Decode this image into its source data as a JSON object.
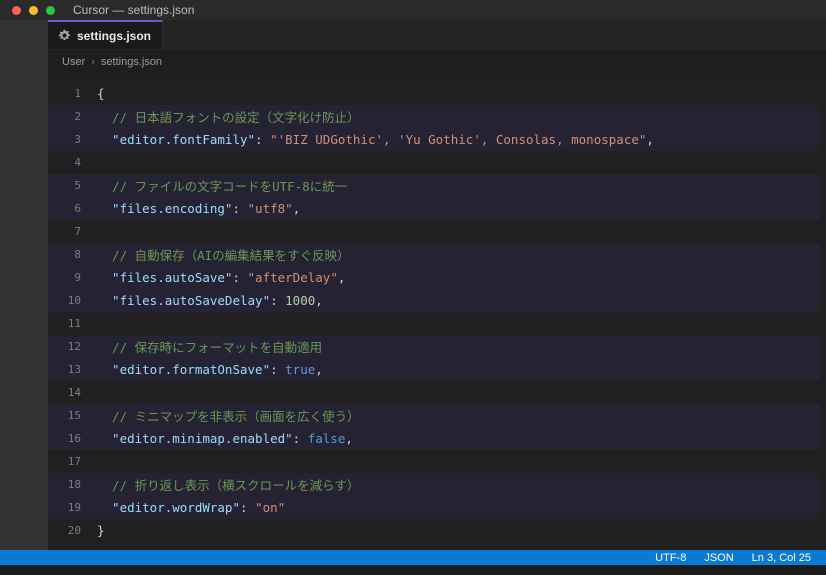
{
  "window": {
    "title": "Cursor — settings.json"
  },
  "tab": {
    "label": "settings.json",
    "icon": "gear-icon"
  },
  "breadcrumb": {
    "segments": [
      "User",
      "settings.json"
    ],
    "separator": "›"
  },
  "editor": {
    "lines": [
      {
        "num": 1,
        "hl": false,
        "tokens": [
          {
            "c": "punct",
            "v": "{"
          }
        ]
      },
      {
        "num": 2,
        "hl": true,
        "tokens": [
          {
            "c": "comment",
            "v": "  // 日本語フォントの設定（文字化け防止）"
          }
        ]
      },
      {
        "num": 3,
        "hl": true,
        "tokens": [
          {
            "c": "key",
            "v": "  \"editor.fontFamily\""
          },
          {
            "c": "punct",
            "v": ": "
          },
          {
            "c": "string",
            "v": "\"'BIZ UDGothic', 'Yu Gothic', Consolas, monospace\""
          },
          {
            "c": "punct",
            "v": ","
          }
        ]
      },
      {
        "num": 4,
        "hl": false,
        "tokens": []
      },
      {
        "num": 5,
        "hl": true,
        "tokens": [
          {
            "c": "comment",
            "v": "  // ファイルの文字コードをUTF-8に統一"
          }
        ]
      },
      {
        "num": 6,
        "hl": true,
        "tokens": [
          {
            "c": "key",
            "v": "  \"files.encoding\""
          },
          {
            "c": "punct",
            "v": ": "
          },
          {
            "c": "string",
            "v": "\"utf8\""
          },
          {
            "c": "punct",
            "v": ","
          }
        ]
      },
      {
        "num": 7,
        "hl": false,
        "tokens": []
      },
      {
        "num": 8,
        "hl": true,
        "tokens": [
          {
            "c": "comment",
            "v": "  // 自動保存（AIの編集結果をすぐ反映）"
          }
        ]
      },
      {
        "num": 9,
        "hl": true,
        "tokens": [
          {
            "c": "key",
            "v": "  \"files.autoSave\""
          },
          {
            "c": "punct",
            "v": ": "
          },
          {
            "c": "string",
            "v": "\"afterDelay\""
          },
          {
            "c": "punct",
            "v": ","
          }
        ]
      },
      {
        "num": 10,
        "hl": true,
        "tokens": [
          {
            "c": "key",
            "v": "  \"files.autoSaveDelay\""
          },
          {
            "c": "punct",
            "v": ": "
          },
          {
            "c": "number",
            "v": "1000"
          },
          {
            "c": "punct",
            "v": ","
          }
        ]
      },
      {
        "num": 11,
        "hl": false,
        "tokens": []
      },
      {
        "num": 12,
        "hl": true,
        "tokens": [
          {
            "c": "comment",
            "v": "  // 保存時にフォーマットを自動適用"
          }
        ]
      },
      {
        "num": 13,
        "hl": true,
        "tokens": [
          {
            "c": "key",
            "v": "  \"editor.formatOnSave\""
          },
          {
            "c": "punct",
            "v": ": "
          },
          {
            "c": "keyword",
            "v": "true"
          },
          {
            "c": "punct",
            "v": ","
          }
        ]
      },
      {
        "num": 14,
        "hl": false,
        "tokens": []
      },
      {
        "num": 15,
        "hl": true,
        "tokens": [
          {
            "c": "comment",
            "v": "  // ミニマップを非表示（画面を広く使う）"
          }
        ]
      },
      {
        "num": 16,
        "hl": true,
        "tokens": [
          {
            "c": "key",
            "v": "  \"editor.minimap.enabled\""
          },
          {
            "c": "punct",
            "v": ": "
          },
          {
            "c": "keyword",
            "v": "false"
          },
          {
            "c": "punct",
            "v": ","
          }
        ]
      },
      {
        "num": 17,
        "hl": false,
        "tokens": []
      },
      {
        "num": 18,
        "hl": true,
        "tokens": [
          {
            "c": "comment",
            "v": "  // 折り返し表示（横スクロールを減らす）"
          }
        ]
      },
      {
        "num": 19,
        "hl": true,
        "tokens": [
          {
            "c": "key",
            "v": "  \"editor.wordWrap\""
          },
          {
            "c": "punct",
            "v": ": "
          },
          {
            "c": "string",
            "v": "\"on\""
          }
        ]
      },
      {
        "num": 20,
        "hl": false,
        "tokens": [
          {
            "c": "punct",
            "v": "}"
          }
        ]
      }
    ]
  },
  "status_bar": {
    "items": [
      "UTF-8",
      "JSON",
      "Ln 3, Col 25"
    ]
  },
  "colors": {
    "accent_purple": "#7a52d9",
    "status_bar_blue": "#0a7ad4",
    "comment_green": "#6a9955",
    "key_blue": "#9cdcfe",
    "string_orange": "#ce9178",
    "number_green": "#b5cea8",
    "keyword_blue": "#569cd6",
    "highlight_row": "#252233",
    "editor_bg": "#202020"
  }
}
